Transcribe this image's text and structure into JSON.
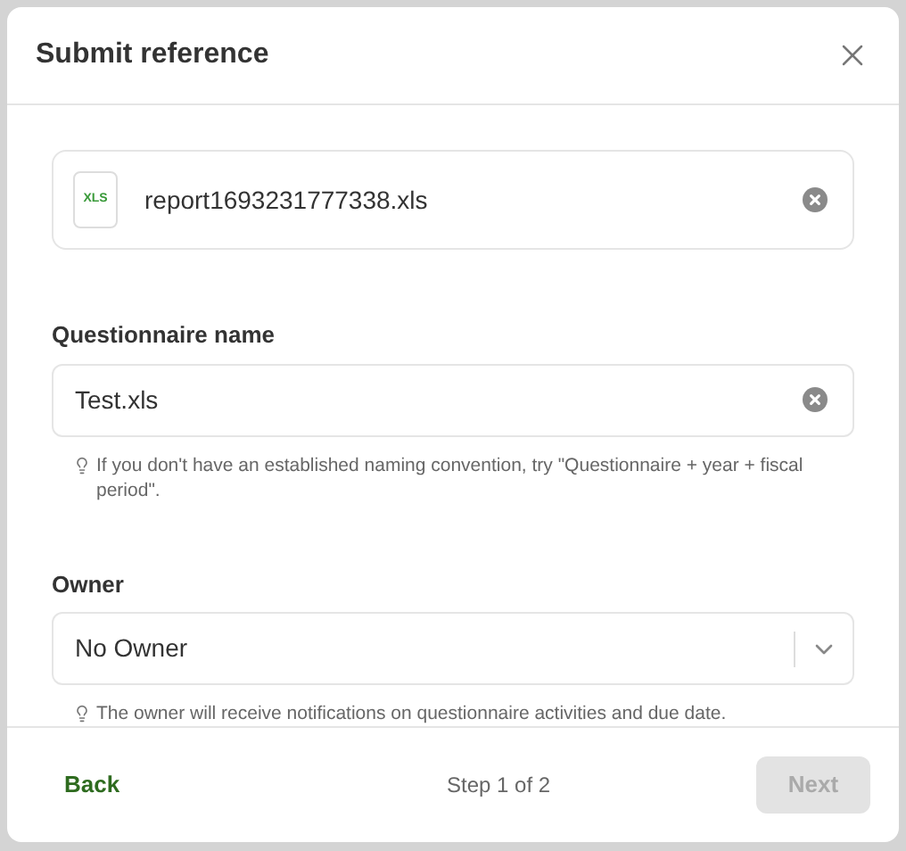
{
  "dialog": {
    "title": "Submit reference"
  },
  "file": {
    "type_label": "XLS",
    "name": "report1693231777338.xls"
  },
  "fields": [
    {
      "kind": "text",
      "label": "Questionnaire name",
      "value": "Test.xls",
      "hint": "If you don't have an established naming convention, try \"Questionnaire + year + fiscal period\"."
    },
    {
      "kind": "select",
      "label": "Owner",
      "value": "No Owner",
      "hint": "The owner will receive notifications on questionnaire activities and due date."
    }
  ],
  "footer": {
    "back": "Back",
    "step": "Step 1 of 2",
    "next": {
      "label": "Next",
      "disabled": true
    }
  }
}
